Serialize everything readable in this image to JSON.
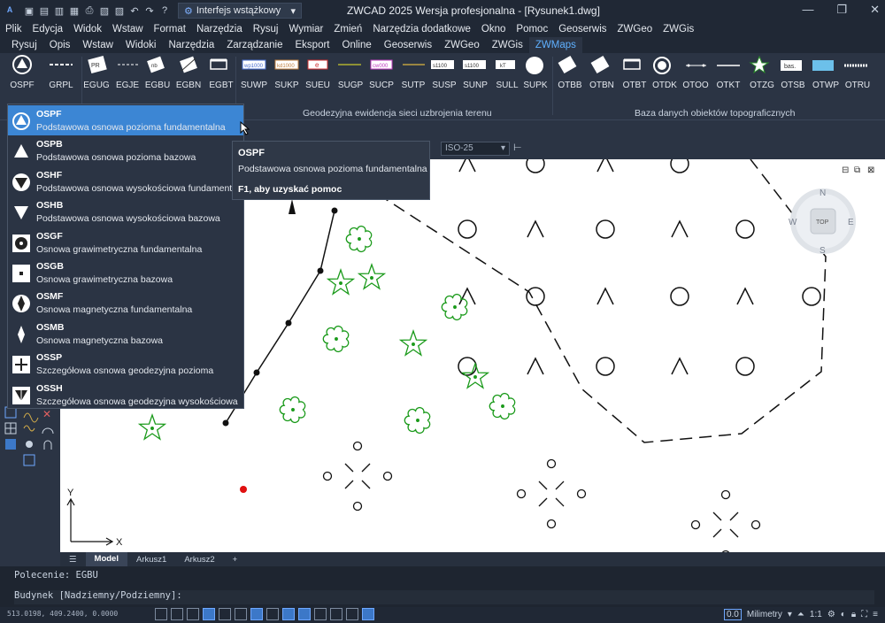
{
  "app": {
    "title": "ZWCAD 2025 Wersja profesjonalna - [Rysunek1.dwg]",
    "workspace": "Interfejs wstążkowy"
  },
  "menu": [
    "Plik",
    "Edycja",
    "Widok",
    "Wstaw",
    "Format",
    "Narzędzia",
    "Rysuj",
    "Wymiar",
    "Zmień",
    "Narzędzia dodatkowe",
    "Okno",
    "Pomoc",
    "Geoserwis",
    "ZWGeo",
    "ZWGis"
  ],
  "ribbon_tabs": [
    "Rysuj",
    "Opis",
    "Wstaw",
    "Widoki",
    "Narzędzia",
    "Zarządzanie",
    "Eksport",
    "Online",
    "Geoserwis",
    "ZWGeo",
    "ZWGis",
    "ZWMaps"
  ],
  "active_tab": "ZWMaps",
  "ribbon": {
    "buttons": [
      "OSPF",
      "GRPL",
      "EGUG",
      "EGJE",
      "EGBU",
      "EGBN",
      "EGBT",
      "SUWP",
      "SUKP",
      "SUEU",
      "SUGP",
      "SUCP",
      "SUTP",
      "SUSP",
      "SUNP",
      "SULL",
      "SUPK",
      "OTBB",
      "OTBN",
      "OTBT",
      "OTDK",
      "OTOO",
      "OTKT",
      "OTZG",
      "OTSB",
      "OTWP",
      "OTRU"
    ],
    "group1": "Geodezyjna ewidencja sieci uzbrojenia terenu",
    "group2": "Baza danych obiektów topograficznych",
    "icon_texts": {
      "suwp": "wp1000",
      "sukp": "kd1000",
      "sueu": "e",
      "sucp": "cw000",
      "susp": "s1100",
      "sunp": "s1100",
      "sulp": "kT",
      "otsb": "bas."
    }
  },
  "dimstyle": "ISO-25",
  "dropdown": [
    {
      "code": "OSPF",
      "desc": "Podstawowa osnowa pozioma fundamentalna"
    },
    {
      "code": "OSPB",
      "desc": "Podstawowa osnowa pozioma bazowa"
    },
    {
      "code": "OSHF",
      "desc": "Podstawowa osnowa wysokościowa fundamentalna"
    },
    {
      "code": "OSHB",
      "desc": "Podstawowa osnowa wysokościowa bazowa"
    },
    {
      "code": "OSGF",
      "desc": "Osnowa grawimetryczna fundamentalna"
    },
    {
      "code": "OSGB",
      "desc": "Osnowa grawimetryczna bazowa"
    },
    {
      "code": "OSMF",
      "desc": "Osnowa magnetyczna fundamentalna"
    },
    {
      "code": "OSMB",
      "desc": "Osnowa magnetyczna bazowa"
    },
    {
      "code": "OSSP",
      "desc": "Szczegółowa osnowa geodezyjna pozioma"
    },
    {
      "code": "OSSH",
      "desc": "Szczegółowa osnowa geodezyjna wysokościowa"
    }
  ],
  "tooltip": {
    "title": "OSPF",
    "desc": "Podstawowa osnowa pozioma fundamentalna",
    "help": "F1, aby uzyskać pomoc"
  },
  "compass": {
    "n": "N",
    "s": "S",
    "e": "E",
    "w": "W",
    "top": "TOP"
  },
  "axes": {
    "x": "X",
    "y": "Y"
  },
  "layout_tabs": [
    "Model",
    "Arkusz1",
    "Arkusz2"
  ],
  "command": {
    "history": "Polecenie: EGBU",
    "prompt": "Budynek [Nadziemny/Podziemny]: "
  },
  "status": {
    "coords": "513.0198, 409.2400, 0.0000",
    "units": "Milimetry",
    "scale": "1:1",
    "units_badge": "0.0"
  },
  "colors": {
    "accent": "#3c86d4",
    "green": "#1a9a1a",
    "red": "#e01010"
  }
}
